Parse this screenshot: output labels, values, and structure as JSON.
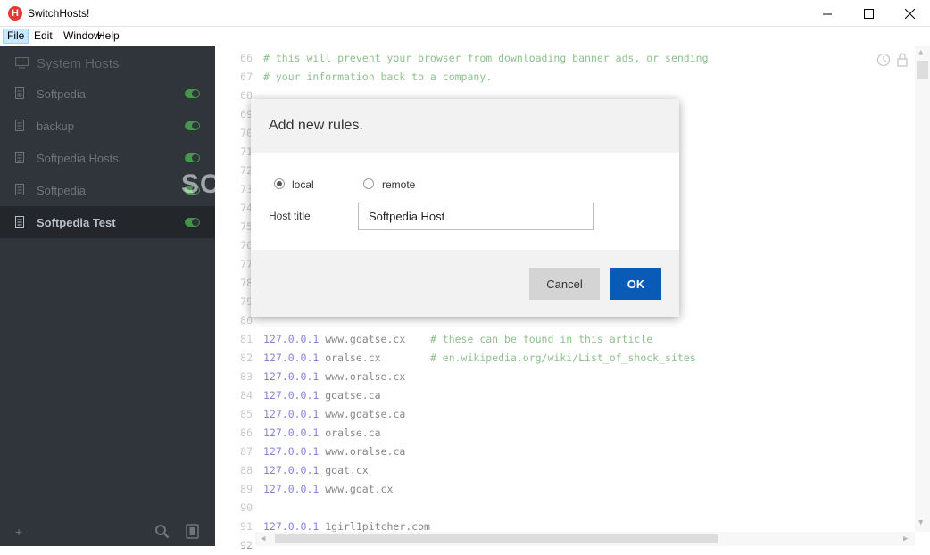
{
  "window": {
    "title": "SwitchHosts!",
    "app_icon_letter": "H"
  },
  "menu": [
    {
      "label": "File",
      "active": true
    },
    {
      "label": "Edit"
    },
    {
      "label": "Window"
    },
    {
      "label": "Help"
    }
  ],
  "sidebar": {
    "system_item": {
      "label": "System Hosts"
    },
    "items": [
      {
        "label": "Softpedia",
        "enabled": true
      },
      {
        "label": "backup",
        "enabled": true
      },
      {
        "label": "Softpedia Hosts",
        "enabled": true
      },
      {
        "label": "Softpedia",
        "enabled": true
      },
      {
        "label": "Softpedia Test",
        "enabled": true,
        "active": true
      }
    ],
    "add_label": "+"
  },
  "editor": {
    "lines": [
      {
        "n": "66",
        "ip": "",
        "host": "",
        "comment": "# this will prevent your browser from downloading banner ads, or sending"
      },
      {
        "n": "67",
        "ip": "",
        "host": "",
        "comment": "# your information back to a company."
      },
      {
        "n": "68",
        "ip": "",
        "host": "",
        "comment": ""
      },
      {
        "n": "69",
        "ip": "",
        "host": "",
        "comment": ""
      },
      {
        "n": "70",
        "ip": "",
        "host": "",
        "comment": ""
      },
      {
        "n": "71",
        "ip": "",
        "host": "",
        "comment": ""
      },
      {
        "n": "72",
        "ip": "",
        "host": "",
        "comment": ""
      },
      {
        "n": "73",
        "ip": "",
        "host": "",
        "comment": ""
      },
      {
        "n": "74",
        "ip": "",
        "host": "",
        "comment": ""
      },
      {
        "n": "75",
        "ip": "",
        "host": "",
        "comment": ""
      },
      {
        "n": "76",
        "ip": "",
        "host": "",
        "comment": ""
      },
      {
        "n": "77",
        "ip": "",
        "host": "",
        "comment": ""
      },
      {
        "n": "78",
        "ip": "",
        "host": "",
        "comment": ""
      },
      {
        "n": "79",
        "ip": "",
        "host": "",
        "comment": ""
      },
      {
        "n": "80",
        "ip": "",
        "host": "",
        "comment": ""
      },
      {
        "n": "81",
        "ip": "127.0.0.1",
        "host": " www.goatse.cx    ",
        "comment": "# these can be found in this article"
      },
      {
        "n": "82",
        "ip": "127.0.0.1",
        "host": " oralse.cx        ",
        "comment": "# en.wikipedia.org/wiki/List_of_shock_sites"
      },
      {
        "n": "83",
        "ip": "127.0.0.1",
        "host": " www.oralse.cx",
        "comment": ""
      },
      {
        "n": "84",
        "ip": "127.0.0.1",
        "host": " goatse.ca",
        "comment": ""
      },
      {
        "n": "85",
        "ip": "127.0.0.1",
        "host": " www.goatse.ca",
        "comment": ""
      },
      {
        "n": "86",
        "ip": "127.0.0.1",
        "host": " oralse.ca",
        "comment": ""
      },
      {
        "n": "87",
        "ip": "127.0.0.1",
        "host": " www.oralse.ca",
        "comment": ""
      },
      {
        "n": "88",
        "ip": "127.0.0.1",
        "host": " goat.cx",
        "comment": ""
      },
      {
        "n": "89",
        "ip": "127.0.0.1",
        "host": " www.goat.cx",
        "comment": ""
      },
      {
        "n": "90",
        "ip": "",
        "host": "",
        "comment": ""
      },
      {
        "n": "91",
        "ip": "127.0.0.1",
        "host": " 1girl1pitcher.com",
        "comment": ""
      },
      {
        "n": "92",
        "ip": "",
        "host": "",
        "comment": ""
      }
    ]
  },
  "dialog": {
    "title": "Add new rules.",
    "source_options": [
      {
        "label": "local",
        "checked": true
      },
      {
        "label": "remote",
        "checked": false
      }
    ],
    "host_title_label": "Host title",
    "host_title_value": "Softpedia Host",
    "cancel_label": "Cancel",
    "ok_label": "OK"
  },
  "watermark": "SOFTPEDIA",
  "colors": {
    "sidebar_bg": "#30353c",
    "toggle_on": "#4caf50",
    "ok_button": "#0a5bb8",
    "ip_text": "#1c1cb8",
    "comment_text": "#2e8b2e"
  }
}
